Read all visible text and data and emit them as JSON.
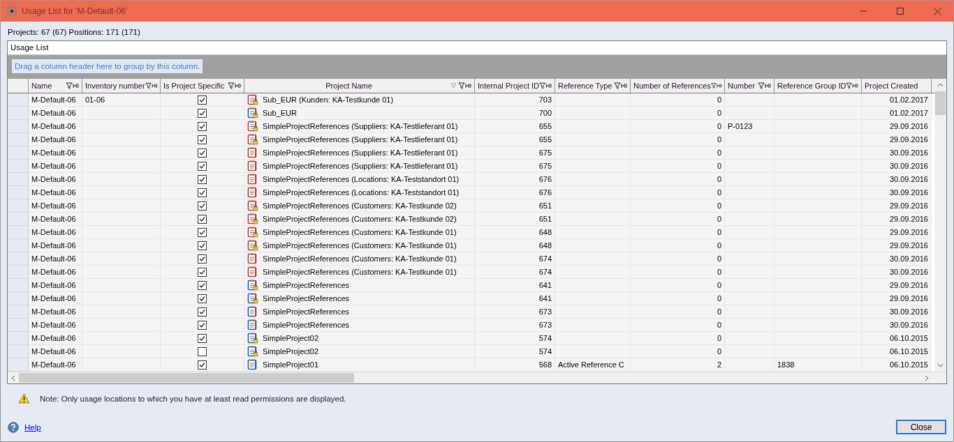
{
  "window": {
    "title": "Usage List for 'M-Default-06'"
  },
  "summary": "Projects: 67 (67) Positions: 171 (171)",
  "panel_title": "Usage List",
  "group_hint": "Drag a column header here to group by this column.",
  "columns": [
    {
      "label": "Name",
      "sorted": false
    },
    {
      "label": "Inventory number",
      "sorted": false
    },
    {
      "label": "Is Project Specific",
      "sorted": false
    },
    {
      "label": "Project Name",
      "sorted": true
    },
    {
      "label": "Internal Project ID",
      "sorted": false
    },
    {
      "label": "Reference Type",
      "sorted": false
    },
    {
      "label": "Number of References",
      "sorted": false
    },
    {
      "label": "Number",
      "sorted": false
    },
    {
      "label": "Reference Group ID",
      "sorted": false
    },
    {
      "label": "Project Created",
      "sorted": false
    }
  ],
  "rows": [
    {
      "name": "M-Default-06",
      "inventory": "01-06",
      "checked": true,
      "kind": "red-locked",
      "project": "Sub_EUR (Kunden: KA-Testkunde 01)",
      "internal_id": "703",
      "ref_type": "",
      "num_refs": "0",
      "number": "",
      "group_id": "",
      "created": "01.02.2017"
    },
    {
      "name": "M-Default-06",
      "inventory": "",
      "checked": true,
      "kind": "mixed-locked",
      "project": "Sub_EUR",
      "internal_id": "700",
      "ref_type": "",
      "num_refs": "0",
      "number": "",
      "group_id": "",
      "created": "01.02.2017"
    },
    {
      "name": "M-Default-06",
      "inventory": "",
      "checked": true,
      "kind": "red-locked",
      "project": "SimpleProjectReferences (Suppliers: KA-Testlieferant 01)",
      "internal_id": "655",
      "ref_type": "",
      "num_refs": "0",
      "number": "P-0123",
      "group_id": "",
      "created": "29.09.2016"
    },
    {
      "name": "M-Default-06",
      "inventory": "",
      "checked": true,
      "kind": "red-locked",
      "project": "SimpleProjectReferences (Suppliers: KA-Testlieferant 01)",
      "internal_id": "655",
      "ref_type": "",
      "num_refs": "0",
      "number": "",
      "group_id": "",
      "created": "29.09.2016"
    },
    {
      "name": "M-Default-06",
      "inventory": "",
      "checked": true,
      "kind": "red",
      "project": "SimpleProjectReferences (Suppliers: KA-Testlieferant 01)",
      "internal_id": "675",
      "ref_type": "",
      "num_refs": "0",
      "number": "",
      "group_id": "",
      "created": "30.09.2016"
    },
    {
      "name": "M-Default-06",
      "inventory": "",
      "checked": true,
      "kind": "red",
      "project": "SimpleProjectReferences (Suppliers: KA-Testlieferant 01)",
      "internal_id": "675",
      "ref_type": "",
      "num_refs": "0",
      "number": "",
      "group_id": "",
      "created": "30.09.2016"
    },
    {
      "name": "M-Default-06",
      "inventory": "",
      "checked": true,
      "kind": "red",
      "project": "SimpleProjectReferences (Locations: KA-Teststandort 01)",
      "internal_id": "676",
      "ref_type": "",
      "num_refs": "0",
      "number": "",
      "group_id": "",
      "created": "30.09.2016"
    },
    {
      "name": "M-Default-06",
      "inventory": "",
      "checked": true,
      "kind": "red",
      "project": "SimpleProjectReferences (Locations: KA-Teststandort 01)",
      "internal_id": "676",
      "ref_type": "",
      "num_refs": "0",
      "number": "",
      "group_id": "",
      "created": "30.09.2016"
    },
    {
      "name": "M-Default-06",
      "inventory": "",
      "checked": true,
      "kind": "red-locked",
      "project": "SimpleProjectReferences (Customers: KA-Testkunde 02)",
      "internal_id": "651",
      "ref_type": "",
      "num_refs": "0",
      "number": "",
      "group_id": "",
      "created": "29.09.2016"
    },
    {
      "name": "M-Default-06",
      "inventory": "",
      "checked": true,
      "kind": "red-locked",
      "project": "SimpleProjectReferences (Customers: KA-Testkunde 02)",
      "internal_id": "651",
      "ref_type": "",
      "num_refs": "0",
      "number": "",
      "group_id": "",
      "created": "29.09.2016"
    },
    {
      "name": "M-Default-06",
      "inventory": "",
      "checked": true,
      "kind": "red-locked",
      "project": "SimpleProjectReferences (Customers: KA-Testkunde 01)",
      "internal_id": "648",
      "ref_type": "",
      "num_refs": "0",
      "number": "",
      "group_id": "",
      "created": "29.09.2016"
    },
    {
      "name": "M-Default-06",
      "inventory": "",
      "checked": true,
      "kind": "red-locked",
      "project": "SimpleProjectReferences (Customers: KA-Testkunde 01)",
      "internal_id": "648",
      "ref_type": "",
      "num_refs": "0",
      "number": "",
      "group_id": "",
      "created": "29.09.2016"
    },
    {
      "name": "M-Default-06",
      "inventory": "",
      "checked": true,
      "kind": "red",
      "project": "SimpleProjectReferences (Customers: KA-Testkunde 01)",
      "internal_id": "674",
      "ref_type": "",
      "num_refs": "0",
      "number": "",
      "group_id": "",
      "created": "30.09.2016"
    },
    {
      "name": "M-Default-06",
      "inventory": "",
      "checked": true,
      "kind": "red",
      "project": "SimpleProjectReferences (Customers: KA-Testkunde 01)",
      "internal_id": "674",
      "ref_type": "",
      "num_refs": "0",
      "number": "",
      "group_id": "",
      "created": "30.09.2016"
    },
    {
      "name": "M-Default-06",
      "inventory": "",
      "checked": true,
      "kind": "mixed-locked",
      "project": "SimpleProjectReferences",
      "internal_id": "641",
      "ref_type": "",
      "num_refs": "0",
      "number": "",
      "group_id": "",
      "created": "29.09.2016"
    },
    {
      "name": "M-Default-06",
      "inventory": "",
      "checked": true,
      "kind": "mixed-locked",
      "project": "SimpleProjectReferences",
      "internal_id": "641",
      "ref_type": "",
      "num_refs": "0",
      "number": "",
      "group_id": "",
      "created": "29.09.2016"
    },
    {
      "name": "M-Default-06",
      "inventory": "",
      "checked": true,
      "kind": "mixed",
      "project": "SimpleProjectReferences",
      "internal_id": "673",
      "ref_type": "",
      "num_refs": "0",
      "number": "",
      "group_id": "",
      "created": "30.09.2016"
    },
    {
      "name": "M-Default-06",
      "inventory": "",
      "checked": true,
      "kind": "mixed",
      "project": "SimpleProjectReferences",
      "internal_id": "673",
      "ref_type": "",
      "num_refs": "0",
      "number": "",
      "group_id": "",
      "created": "30.09.2016"
    },
    {
      "name": "M-Default-06",
      "inventory": "",
      "checked": true,
      "kind": "blue-locked",
      "project": "SimpleProject02",
      "internal_id": "574",
      "ref_type": "",
      "num_refs": "0",
      "number": "",
      "group_id": "",
      "created": "06.10.2015"
    },
    {
      "name": "M-Default-06",
      "inventory": "",
      "checked": false,
      "kind": "blue-locked",
      "project": "SimpleProject02",
      "internal_id": "574",
      "ref_type": "",
      "num_refs": "0",
      "number": "",
      "group_id": "",
      "created": "06.10.2015"
    },
    {
      "name": "M-Default-06",
      "inventory": "",
      "checked": true,
      "kind": "blue",
      "project": "SimpleProject01",
      "internal_id": "568",
      "ref_type": "Active Reference C",
      "num_refs": "2",
      "number": "",
      "group_id": "1838",
      "created": "06.10.2015"
    }
  ],
  "note": "Note: Only usage locations to which you have at least read permissions are displayed.",
  "help_link": "Help",
  "close_button": "Close"
}
